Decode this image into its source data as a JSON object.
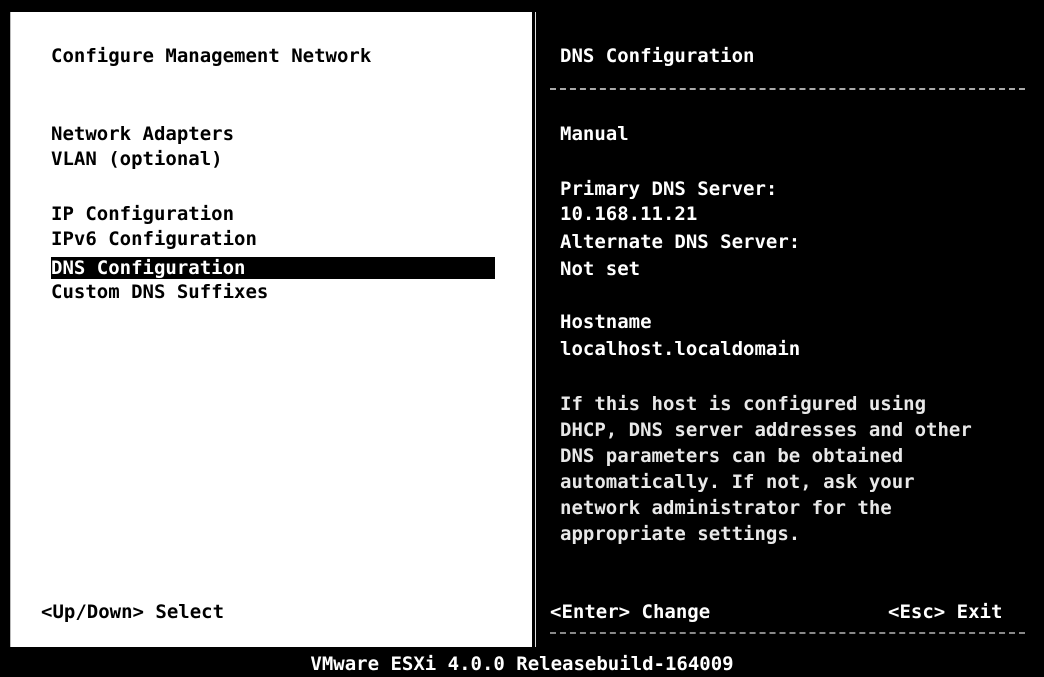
{
  "left_panel": {
    "title": "Configure Management Network",
    "menu_groups": [
      [
        "Network Adapters",
        "VLAN (optional)"
      ],
      [
        "IP Configuration",
        "IPv6 Configuration",
        "DNS Configuration",
        "Custom DNS Suffixes"
      ]
    ],
    "selected_item": "DNS Configuration",
    "footer_hint": "<Up/Down> Select"
  },
  "right_panel": {
    "title": "DNS Configuration",
    "mode": "Manual",
    "primary_dns_label": "Primary DNS Server:",
    "primary_dns_value": "10.168.11.21",
    "alternate_dns_label": "Alternate DNS Server:",
    "alternate_dns_value": "Not set",
    "hostname_label": "Hostname",
    "hostname_value": "localhost.localdomain",
    "help_text": [
      "If this host is configured using",
      "DHCP, DNS server addresses and other",
      "DNS parameters can be obtained",
      "automatically. If not, ask your",
      "network administrator for the",
      "appropriate settings."
    ],
    "enter_hint": "<Enter> Change",
    "esc_hint": "<Esc> Exit"
  },
  "status_bar": "VMware ESXi 4.0.0 Releasebuild-164009"
}
